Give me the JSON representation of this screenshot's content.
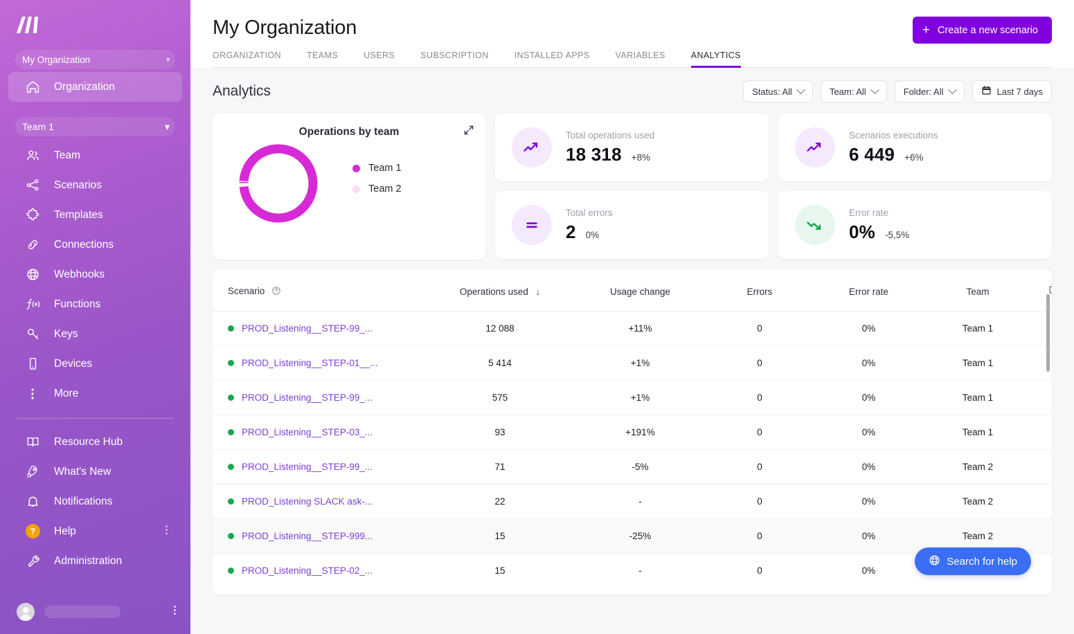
{
  "sidebar": {
    "logo": "make-logo",
    "org_switch": {
      "label": "My Organization",
      "caret": "▾"
    },
    "org_item": {
      "label": "Organization",
      "icon": "home-icon"
    },
    "team_switch": {
      "label": "Team 1",
      "caret": "▾"
    },
    "items": [
      {
        "label": "Team",
        "icon": "users-icon"
      },
      {
        "label": "Scenarios",
        "icon": "share-nodes-icon"
      },
      {
        "label": "Templates",
        "icon": "puzzle-icon"
      },
      {
        "label": "Connections",
        "icon": "link-icon"
      },
      {
        "label": "Webhooks",
        "icon": "globe-icon"
      },
      {
        "label": "Functions",
        "icon": "function-icon"
      },
      {
        "label": "Keys",
        "icon": "key-icon"
      },
      {
        "label": "Devices",
        "icon": "device-icon"
      },
      {
        "label": "More",
        "icon": "dots-vertical-icon"
      }
    ],
    "bottom_items": [
      {
        "label": "Resource Hub",
        "icon": "book-icon"
      },
      {
        "label": "What's New",
        "icon": "rocket-icon"
      },
      {
        "label": "Notifications",
        "icon": "bell-icon"
      },
      {
        "label": "Help",
        "icon": "question-badge-icon"
      },
      {
        "label": "Administration",
        "icon": "wrench-icon"
      }
    ],
    "user": {
      "avatar": "avatar-icon",
      "name": "",
      "menu": "dots-vertical-icon"
    }
  },
  "header": {
    "title": "My Organization",
    "create_button": {
      "label": "Create a new scenario",
      "plus": "+"
    },
    "tabs": [
      {
        "label": "ORGANIZATION",
        "active": false
      },
      {
        "label": "TEAMS",
        "active": false
      },
      {
        "label": "USERS",
        "active": false
      },
      {
        "label": "SUBSCRIPTION",
        "active": false
      },
      {
        "label": "INSTALLED APPS",
        "active": false
      },
      {
        "label": "VARIABLES",
        "active": false
      },
      {
        "label": "ANALYTICS",
        "active": true
      }
    ]
  },
  "analytics": {
    "title": "Analytics",
    "filters": [
      {
        "label": "Status: All",
        "icon": "chevron-down-icon"
      },
      {
        "label": "Team: All",
        "icon": "chevron-down-icon"
      },
      {
        "label": "Folder: All",
        "icon": "chevron-down-icon"
      },
      {
        "label": "Last 7 days",
        "icon": "calendar-icon"
      }
    ],
    "kpis": [
      {
        "label": "Total operations used",
        "value": "18 318",
        "delta": "+8%",
        "icon": "trend-up-icon",
        "icon_bg": "#f4e9fd",
        "icon_color": "#8000e0"
      },
      {
        "label": "Scenarios executions",
        "value": "6 449",
        "delta": "+6%",
        "icon": "trend-up-icon",
        "icon_bg": "#f4e9fd",
        "icon_color": "#8000e0"
      },
      {
        "label": "Total errors",
        "value": "2",
        "delta": "0%",
        "icon": "equals-icon",
        "icon_bg": "#f4e9fd",
        "icon_color": "#8000e0"
      },
      {
        "label": "Error rate",
        "value": "0%",
        "delta": "-5,5%",
        "icon": "trend-down-icon",
        "icon_bg": "#e7f7ed",
        "icon_color": "#16a34a"
      }
    ],
    "help_fab": {
      "label": "Search for help",
      "icon": "globe-icon"
    }
  },
  "chart_data": {
    "type": "pie",
    "title": "Operations by team",
    "categories": [
      "Team 1",
      "Team 2"
    ],
    "values": [
      18226,
      92
    ],
    "colors": [
      "#d62ad6",
      "#fadcf5"
    ],
    "legend_position": "right",
    "donut": true,
    "expand_icon": "expand-icon"
  },
  "table": {
    "columns": [
      {
        "label": "Scenario",
        "icon": "question-circle-icon",
        "sorted": false
      },
      {
        "label": "Operations used",
        "sorted": true,
        "sort_dir": "↓"
      },
      {
        "label": "Usage change",
        "sorted": false
      },
      {
        "label": "Errors",
        "sorted": false
      },
      {
        "label": "Error rate",
        "sorted": false
      },
      {
        "label": "Team",
        "sorted": false
      },
      {
        "label": "",
        "icon": "column-settings-icon"
      }
    ],
    "rows": [
      {
        "status": "active",
        "scenario": "PROD_Listening__STEP-99_...",
        "operations": "12 088",
        "usage_change": "+11%",
        "errors": "0",
        "error_rate": "0%",
        "team": "Team 1",
        "highlight": false
      },
      {
        "status": "active",
        "scenario": "PROD_Listening__STEP-01__...",
        "operations": "5 414",
        "usage_change": "+1%",
        "errors": "0",
        "error_rate": "0%",
        "team": "Team 1",
        "highlight": false
      },
      {
        "status": "active",
        "scenario": "PROD_Listening__STEP-99_...",
        "operations": "575",
        "usage_change": "+1%",
        "errors": "0",
        "error_rate": "0%",
        "team": "Team 1",
        "highlight": false
      },
      {
        "status": "active",
        "scenario": "PROD_Listening__STEP-03_...",
        "operations": "93",
        "usage_change": "+191%",
        "errors": "0",
        "error_rate": "0%",
        "team": "Team 1",
        "highlight": false
      },
      {
        "status": "active",
        "scenario": "PROD_Listening__STEP-99_...",
        "operations": "71",
        "usage_change": "-5%",
        "errors": "0",
        "error_rate": "0%",
        "team": "Team 2",
        "highlight": false
      },
      {
        "status": "active",
        "scenario": "PROD_Listening SLACK ask-...",
        "operations": "22",
        "usage_change": "-",
        "errors": "0",
        "error_rate": "0%",
        "team": "Team 2",
        "highlight": false
      },
      {
        "status": "active",
        "scenario": "PROD_Listening__STEP-999...",
        "operations": "15",
        "usage_change": "-25%",
        "errors": "0",
        "error_rate": "0%",
        "team": "Team 2",
        "highlight": true
      },
      {
        "status": "active",
        "scenario": "PROD_Listening__STEP-02_...",
        "operations": "15",
        "usage_change": "-",
        "errors": "0",
        "error_rate": "0%",
        "team": "",
        "highlight": false
      }
    ]
  }
}
